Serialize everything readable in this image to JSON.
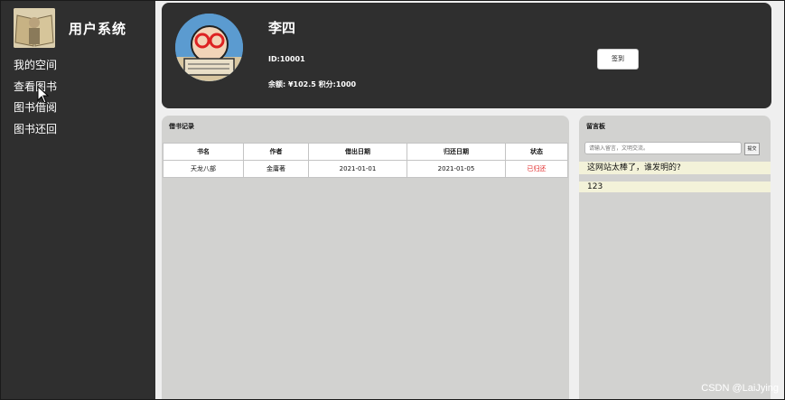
{
  "sidebar": {
    "title": "用户系统",
    "items": [
      {
        "label": "我的空间"
      },
      {
        "label": "查看图书"
      },
      {
        "label": "图书借阅"
      },
      {
        "label": "图书还回"
      }
    ]
  },
  "profile": {
    "name": "李四",
    "id_text": "ID:10001",
    "balance_text": "余额: ¥102.5  积分:1000",
    "signin_label": "签到"
  },
  "records": {
    "title": "借书记录",
    "headers": [
      "书名",
      "作者",
      "借出日期",
      "归还日期",
      "状态"
    ],
    "rows": [
      {
        "book": "天龙八部",
        "author": "金庸著",
        "borrow_date": "2021-01-01",
        "return_date": "2021-01-05",
        "status": "已归还"
      }
    ]
  },
  "board": {
    "title": "留言板",
    "input_placeholder": "请输入留言，文明交流。",
    "submit_label": "提交",
    "messages": [
      {
        "text": "这网站太棒了，谁发明的?"
      },
      {
        "text": "123"
      }
    ]
  },
  "watermark": "CSDN @LaiJying",
  "colors": {
    "dark_panel": "#2f2f2f",
    "content_panel": "#d2d2d0",
    "status_red": "#e02020",
    "message_row": "#f3f2d9"
  }
}
